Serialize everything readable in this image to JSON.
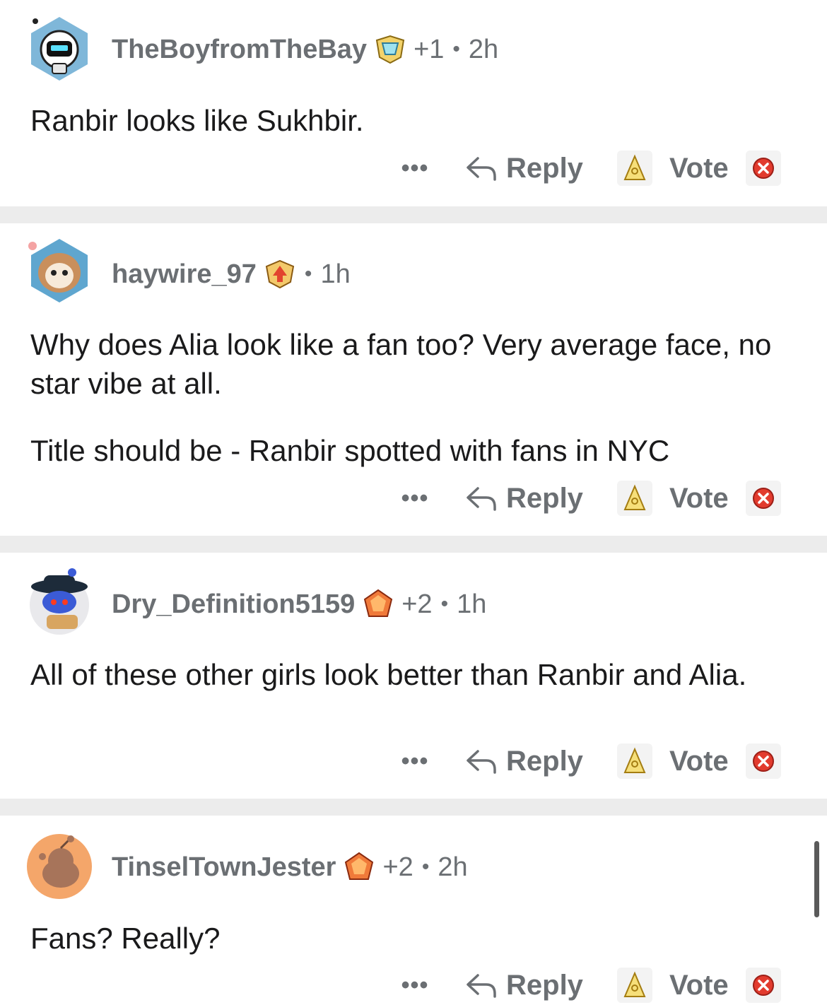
{
  "actions": {
    "more": "•••",
    "reply": "Reply",
    "vote": "Vote"
  },
  "comments": [
    {
      "username": "TheBoyfromTheBay",
      "score": "+1",
      "sep": "•",
      "time": "2h",
      "text": [
        "Ranbir looks like Sukhbir."
      ]
    },
    {
      "username": "haywire_97",
      "score": "",
      "sep": "•",
      "time": "1h",
      "text": [
        "Why does Alia look like a fan too? Very average face, no star vibe at all.",
        "Title should be - Ranbir spotted with fans in NYC"
      ]
    },
    {
      "username": "Dry_Definition5159",
      "score": "+2",
      "sep": "•",
      "time": "1h",
      "text": [
        "All of these other girls look better than Ranbir and Alia."
      ]
    },
    {
      "username": "TinselTownJester",
      "score": "+2",
      "sep": "•",
      "time": "2h",
      "text": [
        "Fans? Really?"
      ]
    }
  ],
  "colors": {
    "meta_gray": "#6b6f73",
    "divider": "#ececec",
    "vote_down_red": "#e23b2e",
    "vote_up_gold": "#d8b53a"
  }
}
